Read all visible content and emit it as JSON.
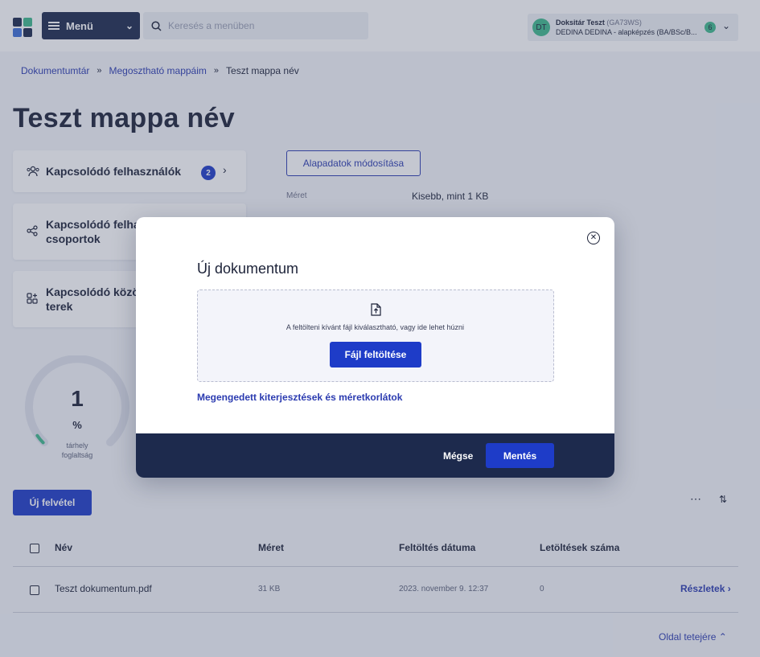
{
  "colors": {
    "navy": "#1d2a4d",
    "accent": "#1e3cc8",
    "link": "#2b3bb0",
    "avatar": "#3fb98d"
  },
  "header": {
    "menu_label": "Menü",
    "search_placeholder": "Keresés a menüben",
    "user": {
      "initials": "DT",
      "name": "Doksitár Teszt",
      "code": "(GA73WS)",
      "subtitle": "DEDINA DEDINA - alapképzés (BA/BSc/B...",
      "badge": "6"
    }
  },
  "breadcrumb": [
    "Dokumentumtár",
    "Megosztható mappáim",
    "Teszt mappa név"
  ],
  "page_title": "Teszt mappa név",
  "side_cards": [
    {
      "icon": "users-icon",
      "label": "Kapcsolódó felhasználók",
      "badge": "2"
    },
    {
      "icon": "share-icon",
      "label_line1": "Kapcsolódó felha",
      "label_line2": "csoportok"
    },
    {
      "icon": "apps-icon",
      "label_line1": "Kapcsolódó közö",
      "label_line2": "terek"
    }
  ],
  "storage": {
    "value": "1",
    "unit": "%",
    "label_line1": "tárhely",
    "label_line2": "foglaltság",
    "fraction": 0.01
  },
  "details": {
    "edit_button": "Alapadatok módosítása",
    "size_key": "Méret",
    "size_value": "Kisebb, mint 1 KB"
  },
  "list": {
    "new_button": "Új felvétel",
    "columns": [
      "Név",
      "Méret",
      "Feltöltés dátuma",
      "Letöltések száma"
    ],
    "rows": [
      {
        "name": "Teszt dokumentum.pdf",
        "size": "31 KB",
        "date": "2023. november 9. 12:37",
        "downloads": "0",
        "action": "Részletek"
      }
    ],
    "to_top": "Oldal tetejére"
  },
  "modal": {
    "title": "Új dokumentum",
    "drop_text": "A feltölteni kívánt fájl kiválasztható, vagy ide lehet húzni",
    "upload_button": "Fájl feltöltése",
    "allowed_link": "Megengedett kiterjesztések és méretkorlátok",
    "cancel": "Mégse",
    "save": "Mentés"
  }
}
